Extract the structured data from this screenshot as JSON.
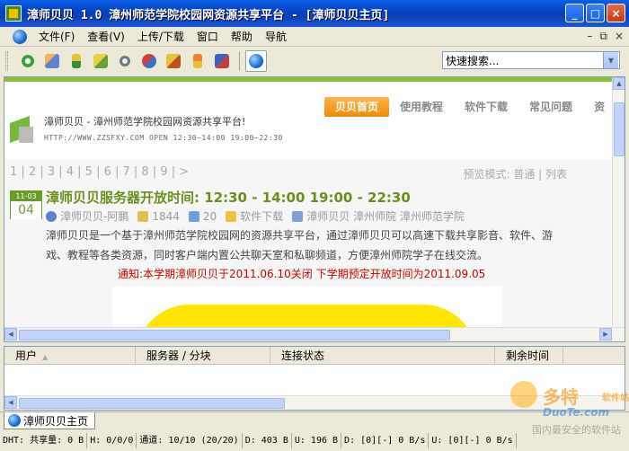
{
  "window": {
    "title": "漳师贝贝 1.0 漳州师范学院校园网资源共享平台 - [漳师贝贝主页]",
    "minimize": "_",
    "maximize": "□",
    "close": "×"
  },
  "menu": {
    "items": [
      "文件(F)",
      "查看(V)",
      "上传/下载",
      "窗口",
      "帮助",
      "导航"
    ],
    "mdi_minimize": "–",
    "mdi_restore": "⧉",
    "mdi_close": "×"
  },
  "toolbar": {
    "icons": [
      "refresh-icon",
      "users-icon",
      "upload-icon",
      "edit-icon",
      "search-icon",
      "connect-icon",
      "pencil-icon",
      "download-icon",
      "send-icon",
      "globe-icon"
    ],
    "search_value": "快速搜索..."
  },
  "page": {
    "nav_tabs": [
      "贝贝首页",
      "使用教程",
      "软件下载",
      "常见问题",
      "资"
    ],
    "site_title": "漳师贝贝 - 漳州师范学院校园网资源共享平台!",
    "site_meta": "HTTP://WWW.ZZSFXY.COM    OPEN 12:30~14:00 19:00~22:30",
    "pager": "1 | 2 | 3 | 4 | 5 | 6 | 7 | 8 | 9 | >",
    "preview_mode": "预览模式: 普通 | 列表",
    "post": {
      "date_month": "11-03",
      "date_day": "04",
      "title": "漳师贝贝服务器开放时间: 12:30 - 14:00 19:00 - 22:30",
      "author": "漳师贝贝-阿鹏",
      "views": "1844",
      "comments": "20",
      "category": "软件下载",
      "tags": "漳师贝贝 漳州师院 漳州师范学院",
      "body": "漳师贝贝是一个基于漳州师范学院校园网的资源共享平台，通过漳师贝贝可以高速下载共享影音、软件、游戏、教程等各类资源，同时客户端内置公共聊天室和私聊频道，方便漳州师院学子在线交流。",
      "notice": "通知:本学期漳师贝贝于2011.06.10关闭 下学期预定开放时间为2011.09.05"
    }
  },
  "transfer_list": {
    "columns": [
      "用户",
      "服务器 / 分块",
      "连接状态",
      "剩余时间"
    ]
  },
  "tabs": {
    "active_tab": "漳师贝贝主页"
  },
  "status": {
    "cells": [
      "DHT: 共享量: 0 B",
      "H: 0/0/0",
      "通道: 10/10 (20/20)",
      "D: 403 B",
      "U: 196 B",
      "D: [0][-] 0 B/s",
      "U: [0][-] 0 B/s"
    ]
  },
  "watermark": {
    "brand": "多特",
    "brand_small": "软件站",
    "domain": "DuoTe.com",
    "tagline": "国内最安全的软件站"
  },
  "colors": {
    "titlebar": "#0a4fd0",
    "accent_green": "#6a8f1e",
    "nav_active": "#f28a0c",
    "notice_red": "#cc0000"
  }
}
